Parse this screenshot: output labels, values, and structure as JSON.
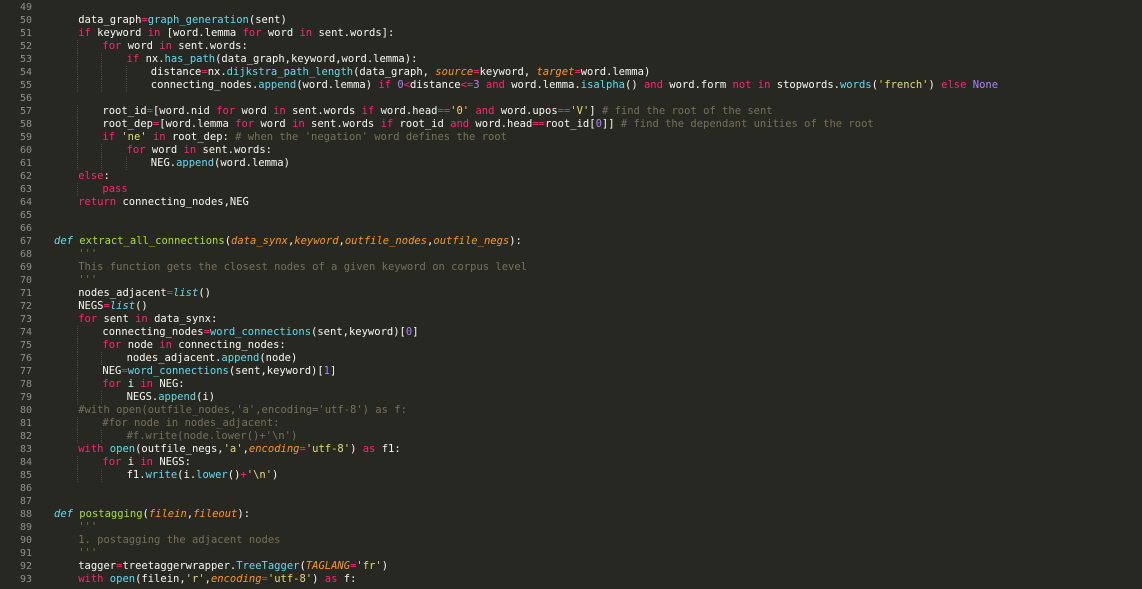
{
  "theme": {
    "background": "#272822",
    "keyword": "#f92672",
    "function": "#a6e22e",
    "call": "#66d9ef",
    "param": "#fd971f",
    "string": "#e6db74",
    "number": "#ae81ff",
    "comment": "#75715e",
    "text": "#f8f8f2"
  },
  "lines": [
    {
      "n": "49",
      "indent": 0,
      "tokens": []
    },
    {
      "n": "50",
      "indent": 1,
      "tokens": [
        [
          "t-plain",
          "data_graph"
        ],
        [
          "t-op",
          "="
        ],
        [
          "t-call",
          "graph_generation"
        ],
        [
          "t-plain",
          "(sent)"
        ]
      ]
    },
    {
      "n": "51",
      "indent": 1,
      "tokens": [
        [
          "t-kw",
          "if "
        ],
        [
          "t-plain",
          "keyword "
        ],
        [
          "t-kw",
          "in "
        ],
        [
          "t-plain",
          "[word.lemma "
        ],
        [
          "t-kw",
          "for "
        ],
        [
          "t-plain",
          "word "
        ],
        [
          "t-kw",
          "in "
        ],
        [
          "t-plain",
          "sent.words]:"
        ]
      ]
    },
    {
      "n": "52",
      "indent": 2,
      "tokens": [
        [
          "t-kw",
          "for "
        ],
        [
          "t-plain",
          "word "
        ],
        [
          "t-kw",
          "in "
        ],
        [
          "t-plain",
          "sent.words:"
        ]
      ]
    },
    {
      "n": "53",
      "indent": 3,
      "tokens": [
        [
          "t-kw",
          "if "
        ],
        [
          "t-plain",
          "nx."
        ],
        [
          "t-call",
          "has_path"
        ],
        [
          "t-plain",
          "(data_graph,keyword,word.lemma):"
        ]
      ]
    },
    {
      "n": "54",
      "indent": 4,
      "tokens": [
        [
          "t-plain",
          "distance"
        ],
        [
          "t-op",
          "="
        ],
        [
          "t-plain",
          "nx."
        ],
        [
          "t-call",
          "dijkstra_path_length"
        ],
        [
          "t-plain",
          "(data_graph, "
        ],
        [
          "t-param",
          "source"
        ],
        [
          "t-op",
          "="
        ],
        [
          "t-plain",
          "keyword, "
        ],
        [
          "t-param",
          "target"
        ],
        [
          "t-op",
          "="
        ],
        [
          "t-plain",
          "word.lemma)"
        ]
      ]
    },
    {
      "n": "55",
      "indent": 4,
      "tokens": [
        [
          "t-plain",
          "connecting_nodes."
        ],
        [
          "t-call",
          "append"
        ],
        [
          "t-plain",
          "(word.lemma) "
        ],
        [
          "t-kw",
          "if "
        ],
        [
          "t-num",
          "0"
        ],
        [
          "t-op",
          "<"
        ],
        [
          "t-plain",
          "distance"
        ],
        [
          "t-op",
          "<="
        ],
        [
          "t-num",
          "3 "
        ],
        [
          "t-kw",
          "and "
        ],
        [
          "t-plain",
          "word.lemma."
        ],
        [
          "t-call",
          "isalpha"
        ],
        [
          "t-plain",
          "() "
        ],
        [
          "t-kw",
          "and "
        ],
        [
          "t-plain",
          "word.form "
        ],
        [
          "t-kw",
          "not in "
        ],
        [
          "t-plain",
          "stopwords."
        ],
        [
          "t-call",
          "words"
        ],
        [
          "t-plain",
          "("
        ],
        [
          "t-str",
          "'french'"
        ],
        [
          "t-plain",
          ") "
        ],
        [
          "t-kw",
          "else "
        ],
        [
          "t-const",
          "None"
        ]
      ]
    },
    {
      "n": "56",
      "indent": 0,
      "tokens": []
    },
    {
      "n": "57",
      "indent": 2,
      "tokens": [
        [
          "t-plain",
          "root_id"
        ],
        [
          "t-op",
          "="
        ],
        [
          "t-plain",
          "[word.nid "
        ],
        [
          "t-kw",
          "for "
        ],
        [
          "t-plain",
          "word "
        ],
        [
          "t-kw",
          "in "
        ],
        [
          "t-plain",
          "sent.words "
        ],
        [
          "t-kw",
          "if "
        ],
        [
          "t-plain",
          "word.head"
        ],
        [
          "t-op",
          "=="
        ],
        [
          "t-str",
          "'0' "
        ],
        [
          "t-kw",
          "and "
        ],
        [
          "t-plain",
          "word.upos"
        ],
        [
          "t-op",
          "=="
        ],
        [
          "t-str",
          "'V'"
        ],
        [
          "t-plain",
          "] "
        ],
        [
          "t-com",
          "# find the root of the sent"
        ]
      ]
    },
    {
      "n": "58",
      "indent": 2,
      "tokens": [
        [
          "t-plain",
          "root_dep"
        ],
        [
          "t-op",
          "="
        ],
        [
          "t-plain",
          "[word.lemma "
        ],
        [
          "t-kw",
          "for "
        ],
        [
          "t-plain",
          "word "
        ],
        [
          "t-kw",
          "in "
        ],
        [
          "t-plain",
          "sent.words "
        ],
        [
          "t-kw",
          "if "
        ],
        [
          "t-plain",
          "root_id "
        ],
        [
          "t-kw",
          "and "
        ],
        [
          "t-plain",
          "word.head"
        ],
        [
          "t-op",
          "=="
        ],
        [
          "t-plain",
          "root_id["
        ],
        [
          "t-num",
          "0"
        ],
        [
          "t-plain",
          "]] "
        ],
        [
          "t-com",
          "# find the dependant unities of the root"
        ]
      ]
    },
    {
      "n": "59",
      "indent": 2,
      "tokens": [
        [
          "t-kw",
          "if "
        ],
        [
          "t-str",
          "'ne' "
        ],
        [
          "t-kw",
          "in "
        ],
        [
          "t-plain",
          "root_dep: "
        ],
        [
          "t-com",
          "# when the 'negation' word defines the root"
        ]
      ]
    },
    {
      "n": "60",
      "indent": 3,
      "tokens": [
        [
          "t-kw",
          "for "
        ],
        [
          "t-plain",
          "word "
        ],
        [
          "t-kw",
          "in "
        ],
        [
          "t-plain",
          "sent.words:"
        ]
      ]
    },
    {
      "n": "61",
      "indent": 4,
      "tokens": [
        [
          "t-plain",
          "NEG."
        ],
        [
          "t-call",
          "append"
        ],
        [
          "t-plain",
          "(word.lemma)"
        ]
      ]
    },
    {
      "n": "62",
      "indent": 1,
      "tokens": [
        [
          "t-kw",
          "else"
        ],
        [
          "t-plain",
          ":"
        ]
      ]
    },
    {
      "n": "63",
      "indent": 2,
      "tokens": [
        [
          "t-kw",
          "pass"
        ]
      ]
    },
    {
      "n": "64",
      "indent": 1,
      "tokens": [
        [
          "t-kw",
          "return "
        ],
        [
          "t-plain",
          "connecting_nodes,NEG"
        ]
      ]
    },
    {
      "n": "65",
      "indent": 0,
      "tokens": []
    },
    {
      "n": "66",
      "indent": 0,
      "tokens": []
    },
    {
      "n": "67",
      "indent": 0,
      "tokens": [
        [
          "t-def",
          "def "
        ],
        [
          "t-fn",
          "extract_all_connections"
        ],
        [
          "t-plain",
          "("
        ],
        [
          "t-param",
          "data_synx"
        ],
        [
          "t-plain",
          ","
        ],
        [
          "t-param",
          "keyword"
        ],
        [
          "t-plain",
          ","
        ],
        [
          "t-param",
          "outfile_nodes"
        ],
        [
          "t-plain",
          ","
        ],
        [
          "t-param",
          "outfile_negs"
        ],
        [
          "t-plain",
          "):"
        ]
      ]
    },
    {
      "n": "68",
      "indent": 1,
      "tokens": [
        [
          "t-com",
          "'''"
        ]
      ]
    },
    {
      "n": "69",
      "indent": 1,
      "tokens": [
        [
          "t-com",
          "This function gets the closest nodes of a given keyword on corpus level"
        ]
      ]
    },
    {
      "n": "70",
      "indent": 1,
      "tokens": [
        [
          "t-com",
          "'''"
        ]
      ]
    },
    {
      "n": "71",
      "indent": 1,
      "tokens": [
        [
          "t-plain",
          "nodes_adjacent"
        ],
        [
          "t-op",
          "="
        ],
        [
          "t-builtin",
          "list"
        ],
        [
          "t-plain",
          "()"
        ]
      ]
    },
    {
      "n": "72",
      "indent": 1,
      "tokens": [
        [
          "t-plain",
          "NEGS"
        ],
        [
          "t-op",
          "="
        ],
        [
          "t-builtin",
          "list"
        ],
        [
          "t-plain",
          "()"
        ]
      ]
    },
    {
      "n": "73",
      "indent": 1,
      "tokens": [
        [
          "t-kw",
          "for "
        ],
        [
          "t-plain",
          "sent "
        ],
        [
          "t-kw",
          "in "
        ],
        [
          "t-plain",
          "data_synx:"
        ]
      ]
    },
    {
      "n": "74",
      "indent": 2,
      "tokens": [
        [
          "t-plain",
          "connecting_nodes"
        ],
        [
          "t-op",
          "="
        ],
        [
          "t-call",
          "word_connections"
        ],
        [
          "t-plain",
          "(sent,keyword)["
        ],
        [
          "t-num",
          "0"
        ],
        [
          "t-plain",
          "]"
        ]
      ]
    },
    {
      "n": "75",
      "indent": 2,
      "tokens": [
        [
          "t-kw",
          "for "
        ],
        [
          "t-plain",
          "node "
        ],
        [
          "t-kw",
          "in "
        ],
        [
          "t-plain",
          "connecting_nodes:"
        ]
      ]
    },
    {
      "n": "76",
      "indent": 3,
      "tokens": [
        [
          "t-plain",
          "nodes_adjacent."
        ],
        [
          "t-call",
          "append"
        ],
        [
          "t-plain",
          "(node)"
        ]
      ]
    },
    {
      "n": "77",
      "indent": 2,
      "tokens": [
        [
          "t-plain",
          "NEG"
        ],
        [
          "t-op",
          "="
        ],
        [
          "t-call",
          "word_connections"
        ],
        [
          "t-plain",
          "(sent,keyword)["
        ],
        [
          "t-num",
          "1"
        ],
        [
          "t-plain",
          "]"
        ]
      ]
    },
    {
      "n": "78",
      "indent": 2,
      "tokens": [
        [
          "t-kw",
          "for "
        ],
        [
          "t-plain",
          "i "
        ],
        [
          "t-kw",
          "in "
        ],
        [
          "t-plain",
          "NEG:"
        ]
      ]
    },
    {
      "n": "79",
      "indent": 3,
      "tokens": [
        [
          "t-plain",
          "NEGS."
        ],
        [
          "t-call",
          "append"
        ],
        [
          "t-plain",
          "(i)"
        ]
      ]
    },
    {
      "n": "80",
      "indent": 1,
      "tokens": [
        [
          "t-com",
          "#with open(outfile_nodes,'a',encoding='utf-8') as f:"
        ]
      ]
    },
    {
      "n": "81",
      "indent": 2,
      "tokens": [
        [
          "t-com",
          "#for node in nodes_adjacent:"
        ]
      ]
    },
    {
      "n": "82",
      "indent": 3,
      "tokens": [
        [
          "t-com",
          "#f.write(node.lower()+'\\n')"
        ]
      ]
    },
    {
      "n": "83",
      "indent": 1,
      "tokens": [
        [
          "t-kw",
          "with "
        ],
        [
          "t-call",
          "open"
        ],
        [
          "t-plain",
          "(outfile_negs,"
        ],
        [
          "t-str",
          "'a'"
        ],
        [
          "t-plain",
          ","
        ],
        [
          "t-param",
          "encoding"
        ],
        [
          "t-op",
          "="
        ],
        [
          "t-str",
          "'utf-8'"
        ],
        [
          "t-plain",
          ") "
        ],
        [
          "t-kw",
          "as "
        ],
        [
          "t-plain",
          "f1:"
        ]
      ]
    },
    {
      "n": "84",
      "indent": 2,
      "tokens": [
        [
          "t-kw",
          "for "
        ],
        [
          "t-plain",
          "i "
        ],
        [
          "t-kw",
          "in "
        ],
        [
          "t-plain",
          "NEGS:"
        ]
      ]
    },
    {
      "n": "85",
      "indent": 3,
      "tokens": [
        [
          "t-plain",
          "f1."
        ],
        [
          "t-call",
          "write"
        ],
        [
          "t-plain",
          "(i."
        ],
        [
          "t-call",
          "lower"
        ],
        [
          "t-plain",
          "()"
        ],
        [
          "t-op",
          "+"
        ],
        [
          "t-str",
          "'\\n'"
        ],
        [
          "t-plain",
          ")"
        ]
      ]
    },
    {
      "n": "86",
      "indent": 0,
      "tokens": []
    },
    {
      "n": "87",
      "indent": 0,
      "tokens": []
    },
    {
      "n": "88",
      "indent": 0,
      "tokens": [
        [
          "t-def",
          "def "
        ],
        [
          "t-fn",
          "postagging"
        ],
        [
          "t-plain",
          "("
        ],
        [
          "t-param",
          "filein"
        ],
        [
          "t-plain",
          ","
        ],
        [
          "t-param",
          "fileout"
        ],
        [
          "t-plain",
          "):"
        ]
      ]
    },
    {
      "n": "89",
      "indent": 1,
      "tokens": [
        [
          "t-com",
          "'''"
        ]
      ]
    },
    {
      "n": "90",
      "indent": 1,
      "tokens": [
        [
          "t-com",
          "1. postagging the adjacent nodes"
        ]
      ]
    },
    {
      "n": "91",
      "indent": 1,
      "tokens": [
        [
          "t-com",
          "'''"
        ]
      ]
    },
    {
      "n": "92",
      "indent": 1,
      "tokens": [
        [
          "t-plain",
          "tagger"
        ],
        [
          "t-op",
          "="
        ],
        [
          "t-plain",
          "treetaggerwrapper."
        ],
        [
          "t-call",
          "TreeTagger"
        ],
        [
          "t-plain",
          "("
        ],
        [
          "t-param",
          "TAGLANG"
        ],
        [
          "t-op",
          "="
        ],
        [
          "t-str",
          "'fr'"
        ],
        [
          "t-plain",
          ")"
        ]
      ]
    },
    {
      "n": "93",
      "indent": 1,
      "tokens": [
        [
          "t-kw",
          "with "
        ],
        [
          "t-call",
          "open"
        ],
        [
          "t-plain",
          "(filein,"
        ],
        [
          "t-str",
          "'r'"
        ],
        [
          "t-plain",
          ","
        ],
        [
          "t-param",
          "encoding"
        ],
        [
          "t-op",
          "="
        ],
        [
          "t-str",
          "'utf-8'"
        ],
        [
          "t-plain",
          ") "
        ],
        [
          "t-kw",
          "as "
        ],
        [
          "t-plain",
          "f:"
        ]
      ]
    }
  ]
}
